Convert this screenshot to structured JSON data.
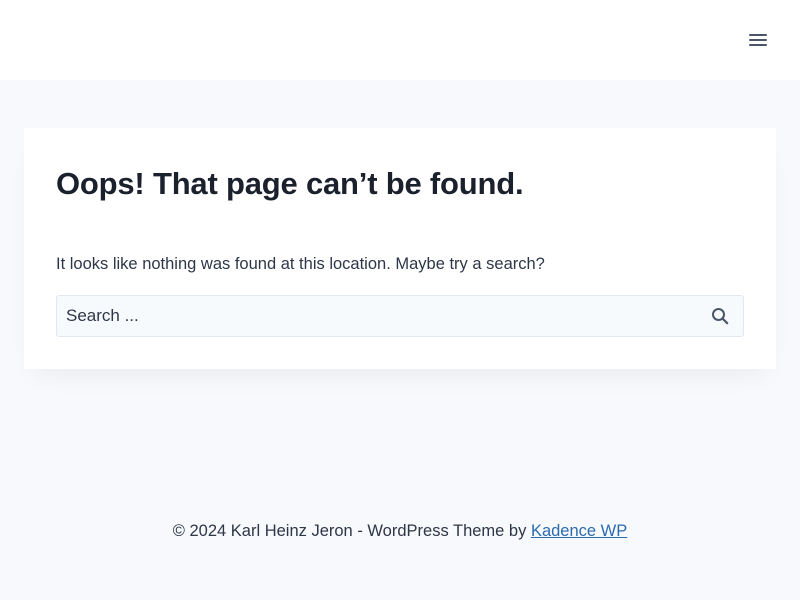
{
  "header": {
    "menu_icon": "hamburger-menu-icon"
  },
  "main": {
    "title": "Oops! That page can’t be found.",
    "message": "It looks like nothing was found at this location. Maybe try a search?",
    "search": {
      "placeholder": "Search ...",
      "value": "",
      "submit_icon": "search-icon"
    }
  },
  "footer": {
    "copyright": "© 2024 Karl Heinz Jeron - WordPress Theme by ",
    "link_text": "Kadence WP"
  },
  "colors": {
    "page_background": "#f7f9fc",
    "card_background": "#ffffff",
    "link": "#2b6cb0",
    "heading": "#1a202c"
  }
}
